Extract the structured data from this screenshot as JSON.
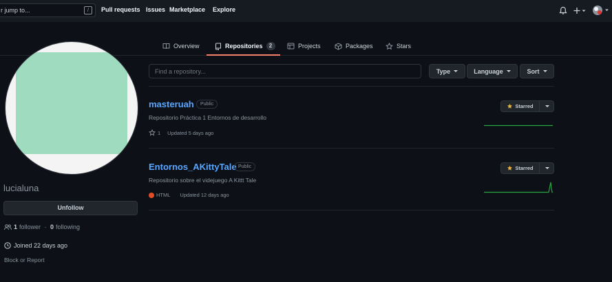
{
  "header": {
    "search_placeholder": "r jump to...",
    "slash_key": "/",
    "nav": [
      "Pull requests",
      "Issues",
      "Marketplace",
      "Explore"
    ]
  },
  "tabs": [
    {
      "label": "Overview",
      "icon": "book-icon"
    },
    {
      "label": "Repositories",
      "icon": "repo-icon",
      "count": "2",
      "active": true
    },
    {
      "label": "Projects",
      "icon": "table-icon"
    },
    {
      "label": "Packages",
      "icon": "package-icon"
    },
    {
      "label": "Stars",
      "icon": "star-icon"
    }
  ],
  "profile": {
    "username": "lucialuna",
    "unfollow_label": "Unfollow",
    "followers_count": "1",
    "followers_label": "follower",
    "separator": " · ",
    "following_count": "0",
    "following_label": "following",
    "joined": "Joined 22 days ago",
    "block_label": "Block or Report",
    "avatar_color": "#9fdcbf"
  },
  "filters": {
    "find_placeholder": "Find a repository...",
    "type_label": "Type",
    "language_label": "Language",
    "sort_label": "Sort"
  },
  "repos": [
    {
      "name": "masteruah",
      "visibility": "Public",
      "description": "Repositorio Práctica 1 Entornos de desarrollo",
      "stars": "1",
      "updated": "Updated 5 days ago",
      "starred_label": "Starred"
    },
    {
      "name": "Entornos_AKittyTale",
      "visibility": "Public",
      "description": "Repositorio sobre el videjuego A Kittt Tale",
      "language": "HTML",
      "language_color": "#e34c26",
      "updated": "Updated 12 days ago",
      "starred_label": "Starred"
    }
  ],
  "colors": {
    "accent_link": "#58a6ff",
    "tab_underline": "#f78166",
    "star": "#e3b341",
    "sparkline": "#26a641"
  }
}
